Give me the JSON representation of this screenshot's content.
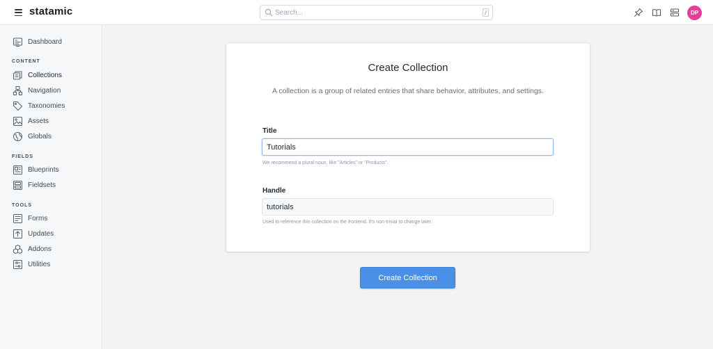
{
  "topbar": {
    "brand": "statamic",
    "search_placeholder": "Search...",
    "search_shortcut": "/",
    "icons": [
      "pin-icon",
      "book-icon",
      "server-icon"
    ],
    "avatar_initials": "DP",
    "avatar_color": "#e2409a"
  },
  "sidebar": {
    "dashboard": "Dashboard",
    "sections": [
      {
        "heading": "CONTENT",
        "items": [
          "Collections",
          "Navigation",
          "Taxonomies",
          "Assets",
          "Globals"
        ]
      },
      {
        "heading": "FIELDS",
        "items": [
          "Blueprints",
          "Fieldsets"
        ]
      },
      {
        "heading": "TOOLS",
        "items": [
          "Forms",
          "Updates",
          "Addons",
          "Utilities"
        ]
      }
    ],
    "active_item": "Collections"
  },
  "form": {
    "title": "Create Collection",
    "description": "A collection is a group of related entries that share behavior, attributes, and settings.",
    "title_field": {
      "label": "Title",
      "value": "Tutorials",
      "help": "We recommend a plural noun, like \"Articles\" or \"Products\"."
    },
    "handle_field": {
      "label": "Handle",
      "value": "tutorials",
      "help": "Used to reference this collection on the frontend. It's non-trivial to change later."
    },
    "submit_label": "Create Collection",
    "accent_color": "#4a90e8"
  }
}
